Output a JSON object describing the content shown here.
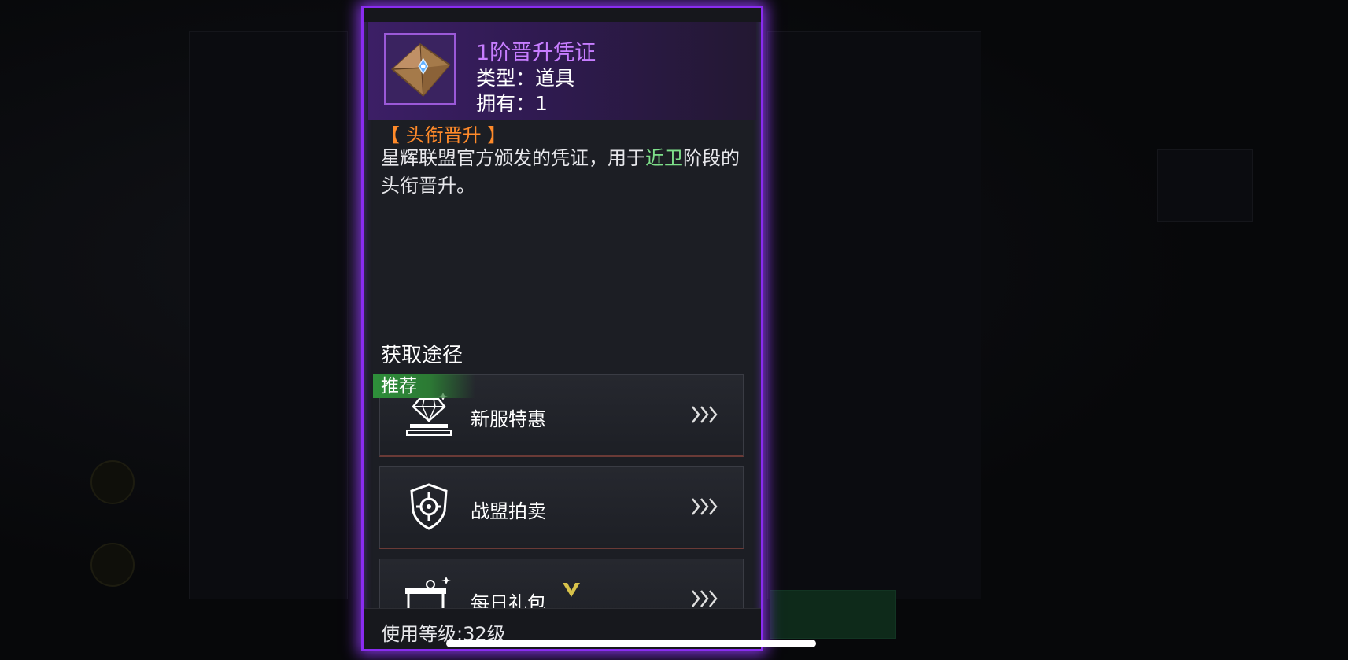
{
  "item": {
    "name": "1阶晋升凭证",
    "type_line": "类型：道具",
    "owned_line": "拥有：1"
  },
  "section_tag": "【 头衔晋升 】",
  "description": {
    "part1": "星辉联盟官方颁发的凭证，用于",
    "highlight": "近卫",
    "part2": "阶段的头衔晋升。"
  },
  "acquisition": {
    "title": "获取途径",
    "recommended_badge": "推荐",
    "routes": [
      {
        "label": "新服特惠",
        "icon": "diamond-podium-icon"
      },
      {
        "label": "战盟拍卖",
        "icon": "shield-target-icon"
      },
      {
        "label": "每日礼包",
        "icon": "gift-box-icon"
      }
    ]
  },
  "footer": {
    "use_level": "使用等级:32级"
  },
  "colors": {
    "border_glow": "#8a2cf0",
    "item_name": "#c77dff",
    "section_tag": "#ff8a2a",
    "highlight": "#7ee08a",
    "recommended": "#2e8f3a"
  }
}
